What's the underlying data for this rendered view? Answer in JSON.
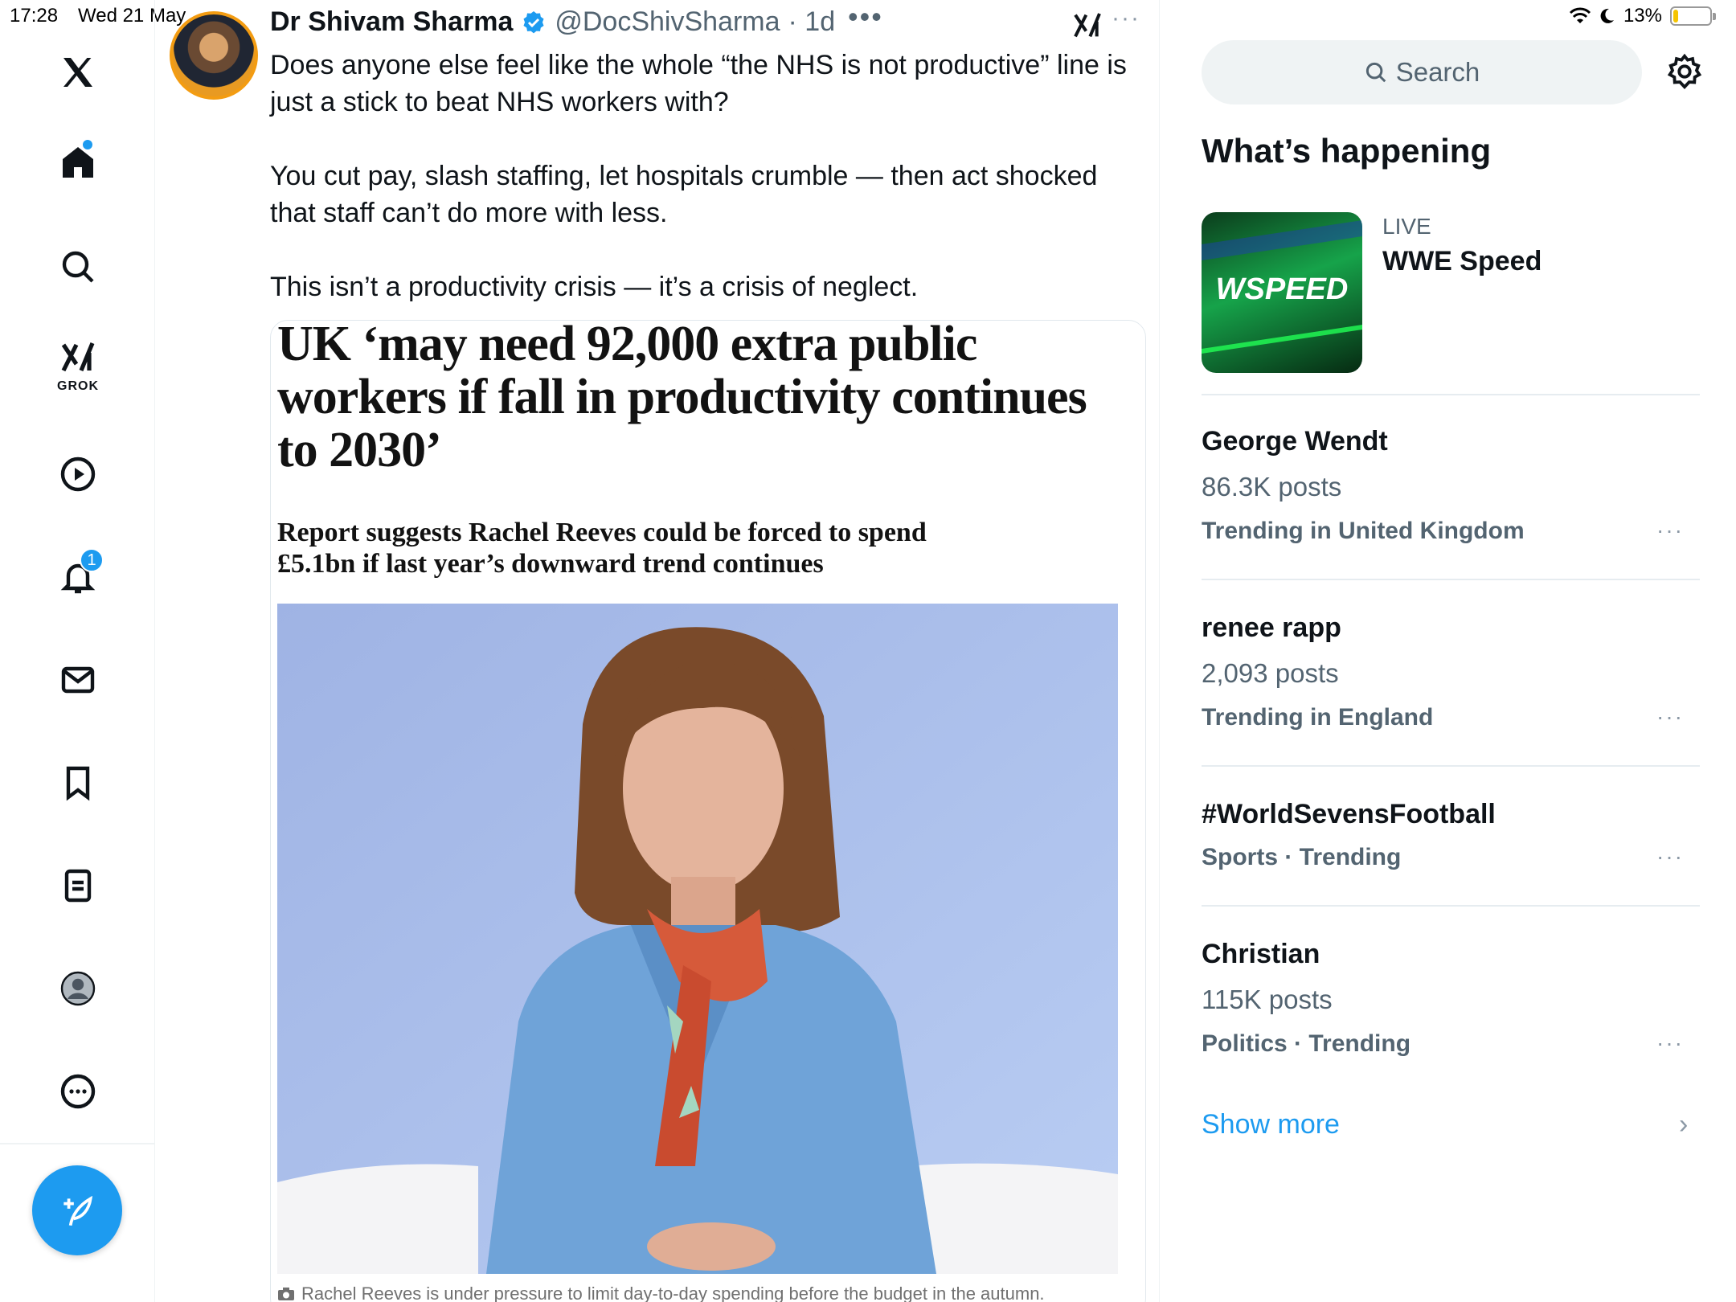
{
  "status_bar": {
    "time": "17:28",
    "date": "Wed 21 May",
    "battery": "13%",
    "battery_level": 0.13
  },
  "nav": {
    "grok_label": "GROK",
    "notifications_badge": "1"
  },
  "tweet": {
    "author_name": "Dr Shivam Sharma",
    "handle": "@DocShivSharma",
    "time": "· 1d",
    "paragraphs": [
      "Does anyone else feel like the whole “the NHS is not productive” line is just a stick to beat NHS workers with?",
      "You cut pay, slash staffing, let hospitals crumble — then act shocked that staff can’t do more with less.",
      "This isn’t a productivity crisis — it’s a crisis of neglect."
    ],
    "article": {
      "headline": "UK ‘may need 92,000 extra public workers if fall in productivity continues to 2030’",
      "standfirst": "Report suggests Rachel Reeves could be forced to spend £5.1bn if last year’s downward trend continues",
      "caption": "Rachel Reeves is under pressure to limit day-to-day spending before the budget in the autumn."
    }
  },
  "sidebar": {
    "search_placeholder": "Search",
    "section_title": "What’s happening",
    "live": {
      "label": "LIVE",
      "title": "WWE Speed"
    },
    "trends": [
      {
        "name": "George Wendt",
        "count": "86.3K posts",
        "context": "Trending in United Kingdom"
      },
      {
        "name": "renee rapp",
        "count": "2,093 posts",
        "context": "Trending in England"
      },
      {
        "name": "#WorldSevensFootball",
        "count": "",
        "context": "Sports · Trending"
      },
      {
        "name": "Christian",
        "count": "115K posts",
        "context": "Politics · Trending"
      }
    ],
    "show_more": "Show more"
  },
  "colors": {
    "accent": "#1d9bf0",
    "text": "#0f1419",
    "muted": "#536471",
    "divider": "#e6ecf0"
  }
}
